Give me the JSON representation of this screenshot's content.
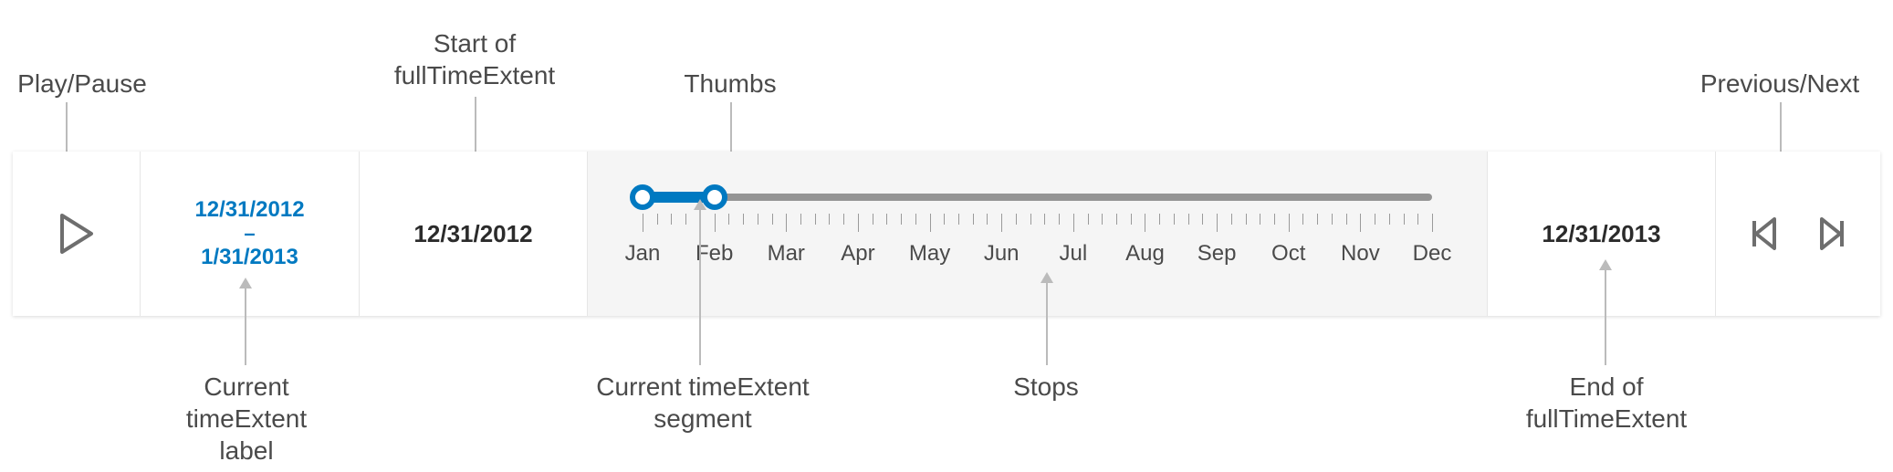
{
  "annotations": {
    "playPause": "Play/Pause",
    "startFull": "Start of\nfullTimeExtent",
    "thumbs": "Thumbs",
    "prevNext": "Previous/Next",
    "currentLabel": "Current\ntimeExtent\nlabel",
    "currentSegment": "Current timeExtent\nsegment",
    "stops": "Stops",
    "endFull": "End of\nfullTimeExtent"
  },
  "widget": {
    "currentExtent": {
      "start": "12/31/2012",
      "end": "1/31/2013",
      "separator": "–"
    },
    "fullExtent": {
      "start": "12/31/2012",
      "end": "12/31/2013"
    },
    "months": [
      "Jan",
      "Feb",
      "Mar",
      "Apr",
      "May",
      "Jun",
      "Jul",
      "Aug",
      "Sep",
      "Oct",
      "Nov",
      "Dec"
    ],
    "thumbPositions": {
      "startIndex": 0,
      "endIndex": 1,
      "totalStops": 12
    },
    "colors": {
      "accent": "#0079c1",
      "rail": "#949494",
      "trackBg": "#f5f5f5"
    }
  }
}
